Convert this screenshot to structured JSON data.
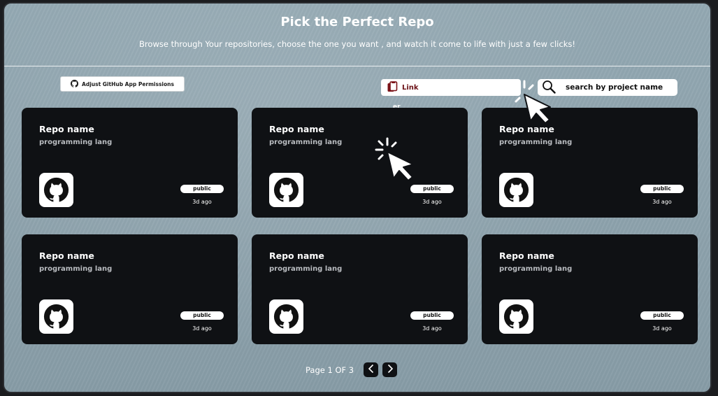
{
  "header": {
    "title": "Pick the Perfect Repo",
    "subtitle": "Browse through Your repositories, choose the one you want , and watch it come to life with just a few clicks!"
  },
  "toolbar": {
    "permissions_label": "Adjust GitHub App Permissions",
    "permissions_icon": "github-icon",
    "link_label": "Link",
    "link_sublabel": "er",
    "link_icon": "clipboard-icon",
    "search_placeholder": "search by project name",
    "search_icon": "search-icon"
  },
  "repos": [
    {
      "name": "Repo name",
      "lang": "programming lang",
      "visibility": "public",
      "updated": "3d ago"
    },
    {
      "name": "Repo name",
      "lang": "programming lang",
      "visibility": "public",
      "updated": "3d ago"
    },
    {
      "name": "Repo name",
      "lang": "programming lang",
      "visibility": "public",
      "updated": "3d ago"
    },
    {
      "name": "Repo name",
      "lang": "programming lang",
      "visibility": "public",
      "updated": "3d ago"
    },
    {
      "name": "Repo name",
      "lang": "programming lang",
      "visibility": "public",
      "updated": "3d ago"
    },
    {
      "name": "Repo name",
      "lang": "programming lang",
      "visibility": "public",
      "updated": "3d ago"
    }
  ],
  "pagination": {
    "label": "Page 1 OF 3",
    "prev_icon": "chevron-left-icon",
    "next_icon": "chevron-right-icon"
  },
  "colors": {
    "background": "#8ea3ad",
    "card": "#0f1114",
    "link_text": "#6b1116"
  }
}
